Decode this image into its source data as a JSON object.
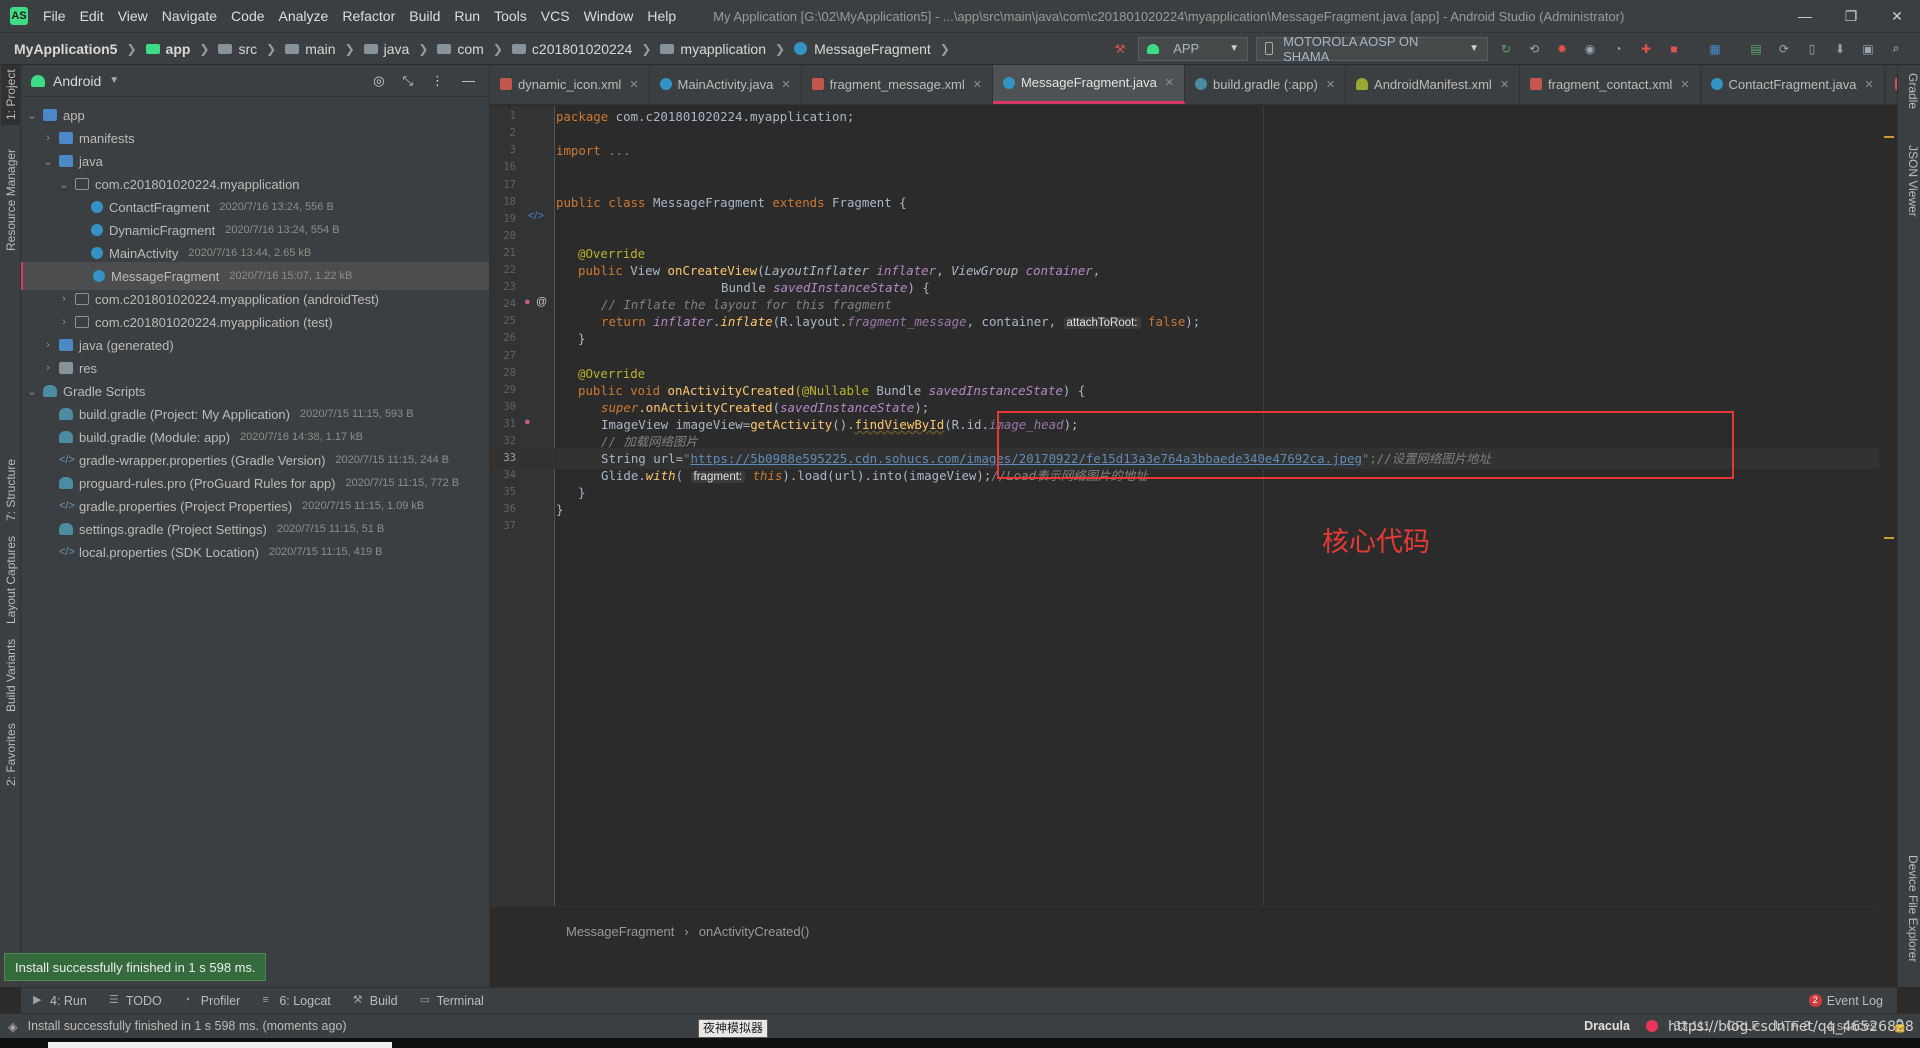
{
  "menubar": {
    "logo": "AS",
    "items": [
      "File",
      "Edit",
      "View",
      "Navigate",
      "Code",
      "Analyze",
      "Refactor",
      "Build",
      "Run",
      "Tools",
      "VCS",
      "Window",
      "Help"
    ],
    "window_title": "My Application [G:\\02\\MyApplication5] - ...\\app\\src\\main\\java\\com\\c201801020224\\myapplication\\MessageFragment.java [app] - Android Studio (Administrator)",
    "minimize": "—",
    "maximize": "❐",
    "close": "✕"
  },
  "breadcrumb": {
    "items": [
      "MyApplication5",
      "app",
      "src",
      "main",
      "java",
      "com",
      "c201801020224",
      "myapplication",
      "MessageFragment"
    ]
  },
  "toolbar": {
    "run_config": "APP",
    "device": "MOTOROLA AOSP ON SHAMA"
  },
  "project_panel": {
    "view_mode": "Android",
    "tree": [
      {
        "label": "app",
        "meta": "",
        "level": 0,
        "arrow": "down",
        "icon": "app"
      },
      {
        "label": "manifests",
        "meta": "",
        "level": 1,
        "arrow": "right",
        "icon": "folder-blue"
      },
      {
        "label": "java",
        "meta": "",
        "level": 1,
        "arrow": "down",
        "icon": "folder-blue"
      },
      {
        "label": "com.c201801020224.myapplication",
        "meta": "",
        "level": 2,
        "arrow": "down",
        "icon": "folder-pkg"
      },
      {
        "label": "ContactFragment",
        "meta": "2020/7/16 13:24, 556 B",
        "level": 3,
        "arrow": "",
        "icon": "cls"
      },
      {
        "label": "DynamicFragment",
        "meta": "2020/7/16 13:24, 554 B",
        "level": 3,
        "arrow": "",
        "icon": "cls"
      },
      {
        "label": "MainActivity",
        "meta": "2020/7/16 13:44, 2.65 kB",
        "level": 3,
        "arrow": "",
        "icon": "cls"
      },
      {
        "label": "MessageFragment",
        "meta": "2020/7/16 15:07, 1.22 kB",
        "level": 3,
        "arrow": "",
        "icon": "cls",
        "selected": true
      },
      {
        "label": "com.c201801020224.myapplication (androidTest)",
        "meta": "",
        "level": 2,
        "arrow": "right",
        "icon": "folder-pkg"
      },
      {
        "label": "com.c201801020224.myapplication (test)",
        "meta": "",
        "level": 2,
        "arrow": "right",
        "icon": "folder-pkg"
      },
      {
        "label": "java (generated)",
        "meta": "",
        "level": 1,
        "arrow": "right",
        "icon": "folder-blue"
      },
      {
        "label": "res",
        "meta": "",
        "level": 1,
        "arrow": "right",
        "icon": "folder-grey"
      },
      {
        "label": "Gradle Scripts",
        "meta": "",
        "level": 0,
        "arrow": "down",
        "icon": "gradle"
      },
      {
        "label": "build.gradle (Project: My Application)",
        "meta": "2020/7/15 11:15, 593 B",
        "level": 1,
        "arrow": "",
        "icon": "gradle"
      },
      {
        "label": "build.gradle (Module: app)",
        "meta": "2020/7/16 14:38, 1.17 kB",
        "level": 1,
        "arrow": "",
        "icon": "gradle"
      },
      {
        "label": "gradle-wrapper.properties (Gradle Version)",
        "meta": "2020/7/15 11:15, 244 B",
        "level": 1,
        "arrow": "",
        "icon": "props"
      },
      {
        "label": "proguard-rules.pro (ProGuard Rules for app)",
        "meta": "2020/7/15 11:15, 772 B",
        "level": 1,
        "arrow": "",
        "icon": "gradle"
      },
      {
        "label": "gradle.properties (Project Properties)",
        "meta": "2020/7/15 11:15, 1.09 kB",
        "level": 1,
        "arrow": "",
        "icon": "props"
      },
      {
        "label": "settings.gradle (Project Settings)",
        "meta": "2020/7/15 11:15, 51 B",
        "level": 1,
        "arrow": "",
        "icon": "gradle"
      },
      {
        "label": "local.properties (SDK Location)",
        "meta": "2020/7/15 11:15, 419 B",
        "level": 1,
        "arrow": "",
        "icon": "props"
      }
    ]
  },
  "left_strip": [
    "1: Project",
    "Resource Manager",
    "7: Structure",
    "Layout Captures",
    "Build Variants",
    "2: Favorites"
  ],
  "right_strip": [
    "Gradle",
    "JSON Viewer",
    "Device File Explorer"
  ],
  "editor_tabs": [
    {
      "label": "dynamic_icon.xml",
      "icon": "xml"
    },
    {
      "label": "MainActivity.java",
      "icon": "java"
    },
    {
      "label": "fragment_message.xml",
      "icon": "xml"
    },
    {
      "label": "MessageFragment.java",
      "icon": "java",
      "active": true
    },
    {
      "label": "build.gradle (:app)",
      "icon": "gradle"
    },
    {
      "label": "AndroidManifest.xml",
      "icon": "manifest"
    },
    {
      "label": "fragment_contact.xml",
      "icon": "xml"
    },
    {
      "label": "ContactFragment.java",
      "icon": "java"
    },
    {
      "label": "f",
      "icon": "xml"
    }
  ],
  "code": {
    "line_numbers": [
      "1",
      "2",
      "3",
      "16",
      "17",
      "18",
      "19",
      "20",
      "21",
      "22",
      "23",
      "24",
      "25",
      "26",
      "27",
      "28",
      "29",
      "30",
      "31",
      "32",
      "33",
      "34",
      "35",
      "36",
      "37"
    ],
    "current_line": "33",
    "l1_kw": "package",
    "l1_rest": " com.c201801020224.myapplication;",
    "l3_kw": "import",
    "l3_rest": " ...",
    "l18_kw1": "public class",
    "l18_name": " MessageFragment ",
    "l18_kw2": "extends",
    "l18_rest": " Fragment {",
    "l21": "@Override",
    "l22_kw": "public",
    "l22_type": " View ",
    "l22_fn": "onCreateView",
    "l22_p1t": "LayoutInflater",
    "l22_p1": " inflater",
    "l22_p2t": "ViewGroup",
    "l22_p2": " container",
    "l23_type": "Bundle ",
    "l23_p": "savedInstanceState",
    "l23_rest": ") {",
    "l24": "// Inflate the layout for this fragment",
    "l25_kw": "return",
    "l25_a": " inflater",
    "l25_b": ".",
    "l25_fn": "inflate",
    "l25_c": "(R.layout.",
    "l25_field": "fragment_message",
    "l25_d": ", container, ",
    "l25_hint": "attachToRoot:",
    "l25_false": "false",
    "l25_end": ");",
    "l26": "}",
    "l28": "@Override",
    "l29_kw": "public void",
    "l29_fn": " onActivityCreated",
    "l29_an": "(@Nullable",
    "l29_type": " Bundle ",
    "l29_p": "savedInstanceState",
    "l29_rest": ") {",
    "l30_kw": "super",
    "l30_fn": ".onActivityCreated",
    "l30_p": "savedInstanceState",
    "l30_rest": ");",
    "l31_a": "ImageView imageView=",
    "l31_fn": "getActivity",
    "l31_b": "().",
    "l31_fn2": "findViewById",
    "l31_c": "(R.id.",
    "l31_field": "image_head",
    "l31_d": ");",
    "l32": "// 加载网络图片",
    "l33_a": "String url=",
    "l33_q": "\"",
    "l33_url": "https://5b0988e595225.cdn.sohucs.com/images/20170922/fe15d13a3e764a3bbaede340e47692ca.jpeg",
    "l33_q2": "\";",
    "l33_cm": "//设置网络图片地址",
    "l34_a": "Glide.",
    "l34_fn": "with",
    "l34_hint": "fragment:",
    "l34_this": "this",
    "l34_b": ").load(url).into(imageView);",
    "l34_cm": "//Load表示网络图片的地址",
    "l35": "}",
    "l36": "}"
  },
  "annotation_label": "核心代码",
  "editor_breadcrumb": [
    "MessageFragment",
    "onActivityCreated()"
  ],
  "tool_windows": [
    "4: Run",
    "TODO",
    "Profiler",
    "6: Logcat",
    "Build",
    "Terminal"
  ],
  "event_log": {
    "count": "2",
    "label": "Event Log"
  },
  "status": {
    "message": "Install successfully finished in 1 s 598 ms. (moments ago)",
    "theme": "Dracula",
    "position": "33:111",
    "line_sep": "CRLF",
    "encoding": "UTF-8",
    "indent": "4 spaces"
  },
  "toast": "Install successfully finished in 1 s 598 ms.",
  "tooltip": "夜神模拟器",
  "watermark": "https://blog.csdn.net/qq_46526828"
}
